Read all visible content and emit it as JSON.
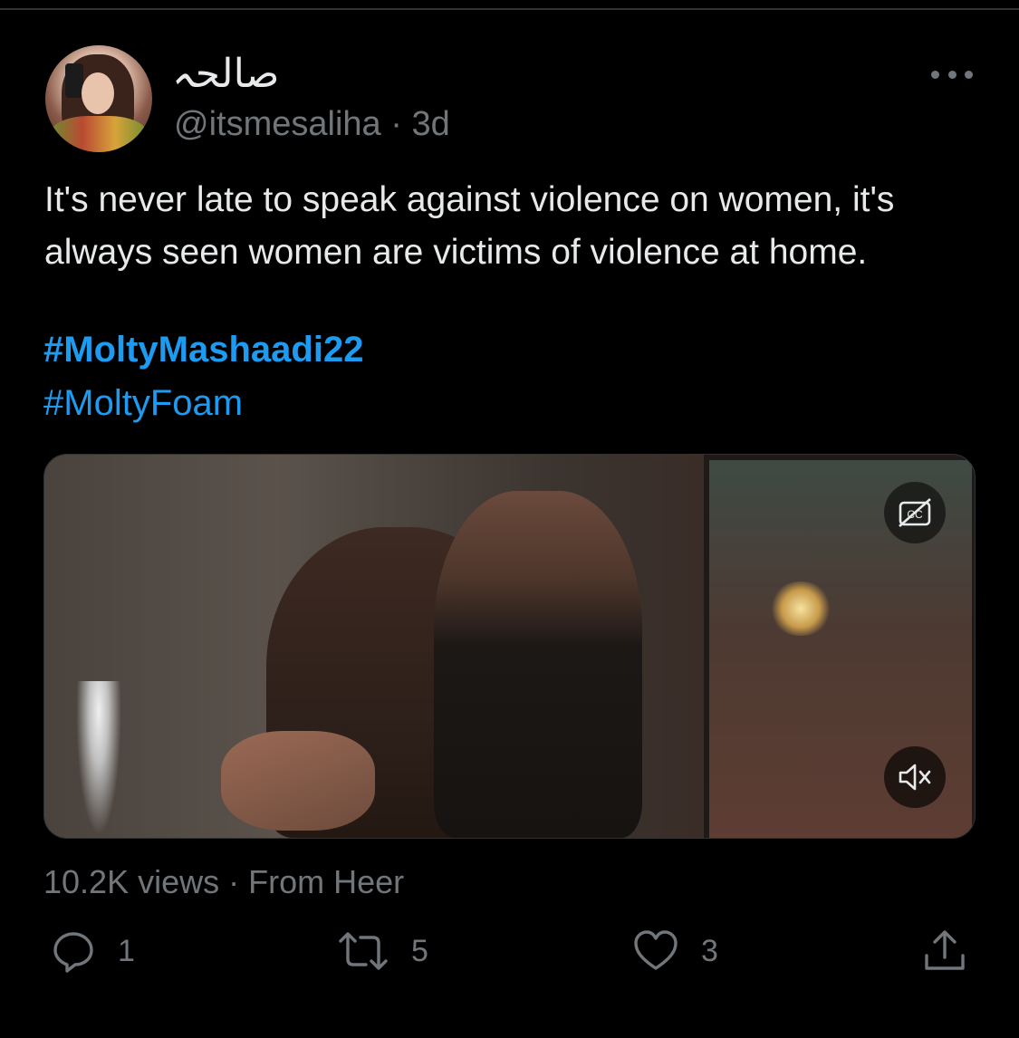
{
  "tweet": {
    "display_name": "صالحہ",
    "handle": "@itsmesaliha",
    "separator": " · ",
    "time": "3d",
    "text": "It's never late to speak against violence on women, it's always seen women are victims of violence at home.",
    "hashtags": [
      "#MoltyMashaadi22",
      "#MoltyFoam"
    ]
  },
  "media": {
    "cc_label": "CC"
  },
  "meta": {
    "views": "10.2K views",
    "separator": " · ",
    "source": "From Heer"
  },
  "actions": {
    "replies": "1",
    "retweets": "5",
    "likes": "3"
  },
  "icons": {
    "more": "more-horizontal-icon",
    "cc": "closed-captions-icon",
    "mute": "volume-muted-icon",
    "reply": "reply-icon",
    "retweet": "retweet-icon",
    "like": "heart-icon",
    "share": "share-icon"
  },
  "colors": {
    "background": "#000000",
    "text": "#e7e9ea",
    "secondary": "#71767b",
    "accent": "#1d9bf0"
  }
}
